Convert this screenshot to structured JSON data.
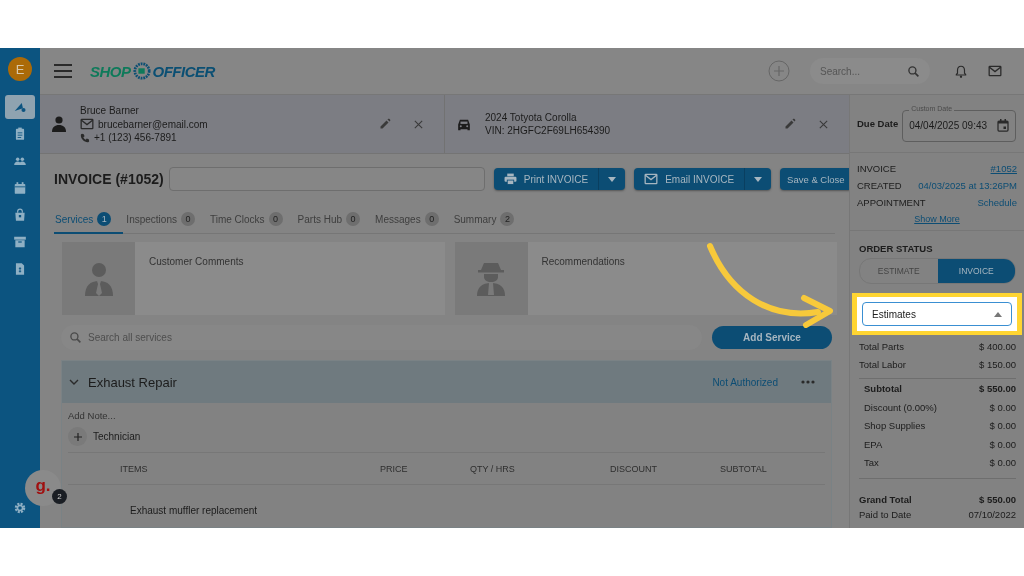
{
  "app": {
    "avatar": "E",
    "logo": {
      "left": "SHOP",
      "right": "OFFICER"
    },
    "search_placeholder": "Search..."
  },
  "sidebar": {
    "items": [
      {
        "selected": true
      },
      {
        "selected": false
      },
      {
        "selected": false
      },
      {
        "selected": false
      },
      {
        "selected": false
      },
      {
        "selected": false
      },
      {
        "selected": false
      }
    ]
  },
  "help_widget": {
    "label": "g.",
    "badge": "2"
  },
  "customer": {
    "name": "Bruce Barner",
    "email": "brucebarner@email.com",
    "phone": "+1 (123) 456-7891"
  },
  "vehicle": {
    "title": "2024 Totyota Corolla",
    "vin": "VIN: 2HGFC2F69LH654390"
  },
  "invoice": {
    "title": "INVOICE (#1052)",
    "buttons": [
      {
        "label": "Print INVOICE",
        "kind": "print"
      },
      {
        "label": "Email INVOICE",
        "kind": "email"
      },
      {
        "label": "Save & Close",
        "kind": "plain"
      }
    ]
  },
  "tabs": [
    {
      "label": "Services",
      "count": "1",
      "selected": true
    },
    {
      "label": "Inspections",
      "count": "0",
      "selected": false
    },
    {
      "label": "Time Clocks",
      "count": "0",
      "selected": false
    },
    {
      "label": "Parts Hub",
      "count": "0",
      "selected": false
    },
    {
      "label": "Messages",
      "count": "0",
      "selected": false
    },
    {
      "label": "Summary",
      "count": "2",
      "selected": false
    }
  ],
  "cards": [
    {
      "title": "Customer Comments",
      "kind": "customer"
    },
    {
      "title": "Recommendations",
      "kind": "spy"
    }
  ],
  "services_search": {
    "placeholder": "Search all services"
  },
  "add_service": "Add Service",
  "service": {
    "title": "Exhaust Repair",
    "expanded": true,
    "status": "Not Authorized",
    "note_placeholder": "Add Note...",
    "technician": "Technician",
    "columns": [
      "ITEMS",
      "PRICE",
      "QTY / HRS",
      "DISCOUNT",
      "SUBTOTAL"
    ],
    "rows": [
      [
        "Exhaust muffler replacement"
      ]
    ]
  },
  "due_date": {
    "label": "Due Date",
    "field_label": "Custom Date",
    "value": "04/04/2025 09:43"
  },
  "info": [
    {
      "label": "INVOICE",
      "value": "#1052",
      "kind": "underlined"
    },
    {
      "label": "CREATED",
      "value": "04/03/2025 at 13:26PM",
      "kind": "link"
    },
    {
      "label": "APPOINTMENT",
      "value": "Schedule",
      "kind": "link"
    }
  ],
  "show_more": "Show More",
  "order_status": {
    "label": "ORDER STATUS",
    "options": [
      {
        "label": "ESTIMATE",
        "selected": false
      },
      {
        "label": "INVOICE",
        "selected": true
      }
    ]
  },
  "workflow": {
    "value": "Estimates",
    "highlighted": true
  },
  "totals": [
    {
      "label": "Total Parts",
      "value": "$ 400.00",
      "kind": "plain"
    },
    {
      "label": "Total Labor",
      "value": "$ 150.00",
      "kind": "plain"
    },
    {
      "label": "Subtotal",
      "value": "$ 550.00",
      "kind": "sub-bold"
    },
    {
      "label": "Discount (0.00%)",
      "value": "$ 0.00",
      "kind": "sub"
    },
    {
      "label": "Shop Supplies",
      "value": "$ 0.00",
      "kind": "sub"
    },
    {
      "label": "EPA",
      "value": "$ 0.00",
      "kind": "sub"
    },
    {
      "label": "Tax",
      "value": "$ 0.00",
      "kind": "sub"
    },
    {
      "label": "Grand Total",
      "value": "$ 550.00",
      "kind": "grand"
    },
    {
      "label": "Paid to Date",
      "value": "07/10/2022",
      "kind": "plain"
    }
  ]
}
